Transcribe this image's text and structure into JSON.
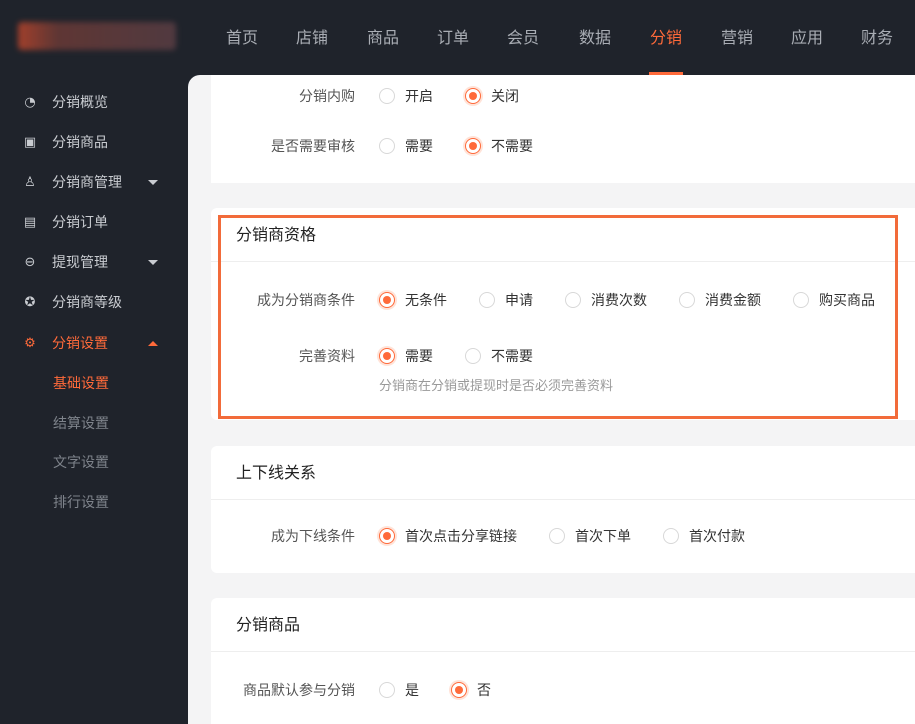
{
  "topnav": [
    "首页",
    "店铺",
    "商品",
    "订单",
    "会员",
    "数据",
    "分销",
    "营销",
    "应用",
    "财务"
  ],
  "topnav_active": 6,
  "sidebar": {
    "items": [
      "分销概览",
      "分销商品",
      "分销商管理",
      "分销订单",
      "提现管理",
      "分销商等级",
      "分销设置"
    ],
    "sub": [
      "基础设置",
      "结算设置",
      "文字设置",
      "排行设置"
    ]
  },
  "card1": {
    "rows": [
      {
        "label": "分销内购",
        "options": [
          "开启",
          "关闭"
        ],
        "selected": 1
      },
      {
        "label": "是否需要审核",
        "options": [
          "需要",
          "不需要"
        ],
        "selected": 1
      }
    ]
  },
  "card2": {
    "title": "分销商资格",
    "rows": [
      {
        "label": "成为分销商条件",
        "options": [
          "无条件",
          "申请",
          "消费次数",
          "消费金额",
          "购买商品"
        ],
        "selected": 0
      },
      {
        "label": "完善资料",
        "options": [
          "需要",
          "不需要"
        ],
        "selected": 0
      }
    ],
    "hint": "分销商在分销或提现时是否必须完善资料"
  },
  "card3": {
    "title": "上下线关系",
    "rows": [
      {
        "label": "成为下线条件",
        "options": [
          "首次点击分享链接",
          "首次下单",
          "首次付款"
        ],
        "selected": 0
      }
    ]
  },
  "card4": {
    "title": "分销商品",
    "rows": [
      {
        "label": "商品默认参与分销",
        "options": [
          "是",
          "否"
        ],
        "selected": 1
      }
    ]
  },
  "accent": "#ff6a3a"
}
